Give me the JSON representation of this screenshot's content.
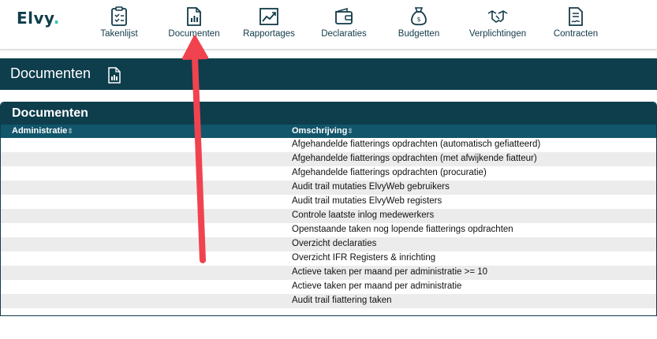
{
  "brand": {
    "logo_text": "Elvy",
    "logo_dot": ".",
    "accent": "#2ec4b6",
    "primary": "#0e3d4c"
  },
  "nav": [
    {
      "label": "Takenlijst",
      "icon": "clipboard-icon"
    },
    {
      "label": "Documenten",
      "icon": "document-chart-icon"
    },
    {
      "label": "Rapportages",
      "icon": "line-chart-icon"
    },
    {
      "label": "Declaraties",
      "icon": "wallet-icon"
    },
    {
      "label": "Budgetten",
      "icon": "money-bag-icon"
    },
    {
      "label": "Verplichtingen",
      "icon": "handshake-icon"
    },
    {
      "label": "Contracten",
      "icon": "contract-icon"
    }
  ],
  "page": {
    "title": "Documenten",
    "title_icon": "document-chart-icon"
  },
  "panel": {
    "title": "Documenten",
    "columns": [
      {
        "label": "Administratie",
        "sort_icon": "⇳"
      },
      {
        "label": "Omschrijving",
        "sort_icon": "⇳"
      }
    ],
    "rows": [
      {
        "administratie": "",
        "omschrijving": "Afgehandelde fiatterings opdrachten (automatisch gefiatteerd)"
      },
      {
        "administratie": "",
        "omschrijving": "Afgehandelde fiatterings opdrachten (met afwijkende fiatteur)"
      },
      {
        "administratie": "",
        "omschrijving": "Afgehandelde fiatterings opdrachten (procuratie)"
      },
      {
        "administratie": "",
        "omschrijving": "Audit trail mutaties ElvyWeb gebruikers"
      },
      {
        "administratie": "",
        "omschrijving": "Audit trail mutaties ElvyWeb registers"
      },
      {
        "administratie": "",
        "omschrijving": "Controle laatste inlog medewerkers"
      },
      {
        "administratie": "",
        "omschrijving": "Openstaande taken nog lopende fiatterings opdrachten"
      },
      {
        "administratie": "",
        "omschrijving": "Overzicht declaraties"
      },
      {
        "administratie": "",
        "omschrijving": "Overzicht IFR Registers & inrichting"
      },
      {
        "administratie": "",
        "omschrijving": "Actieve taken per maand per administratie >= 10"
      },
      {
        "administratie": "",
        "omschrijving": "Actieve taken per maand per administratie"
      },
      {
        "administratie": "",
        "omschrijving": "Audit trail fiattering taken"
      }
    ]
  },
  "annotation": {
    "type": "arrow",
    "color": "#f0434f",
    "points_to": "Documenten"
  }
}
